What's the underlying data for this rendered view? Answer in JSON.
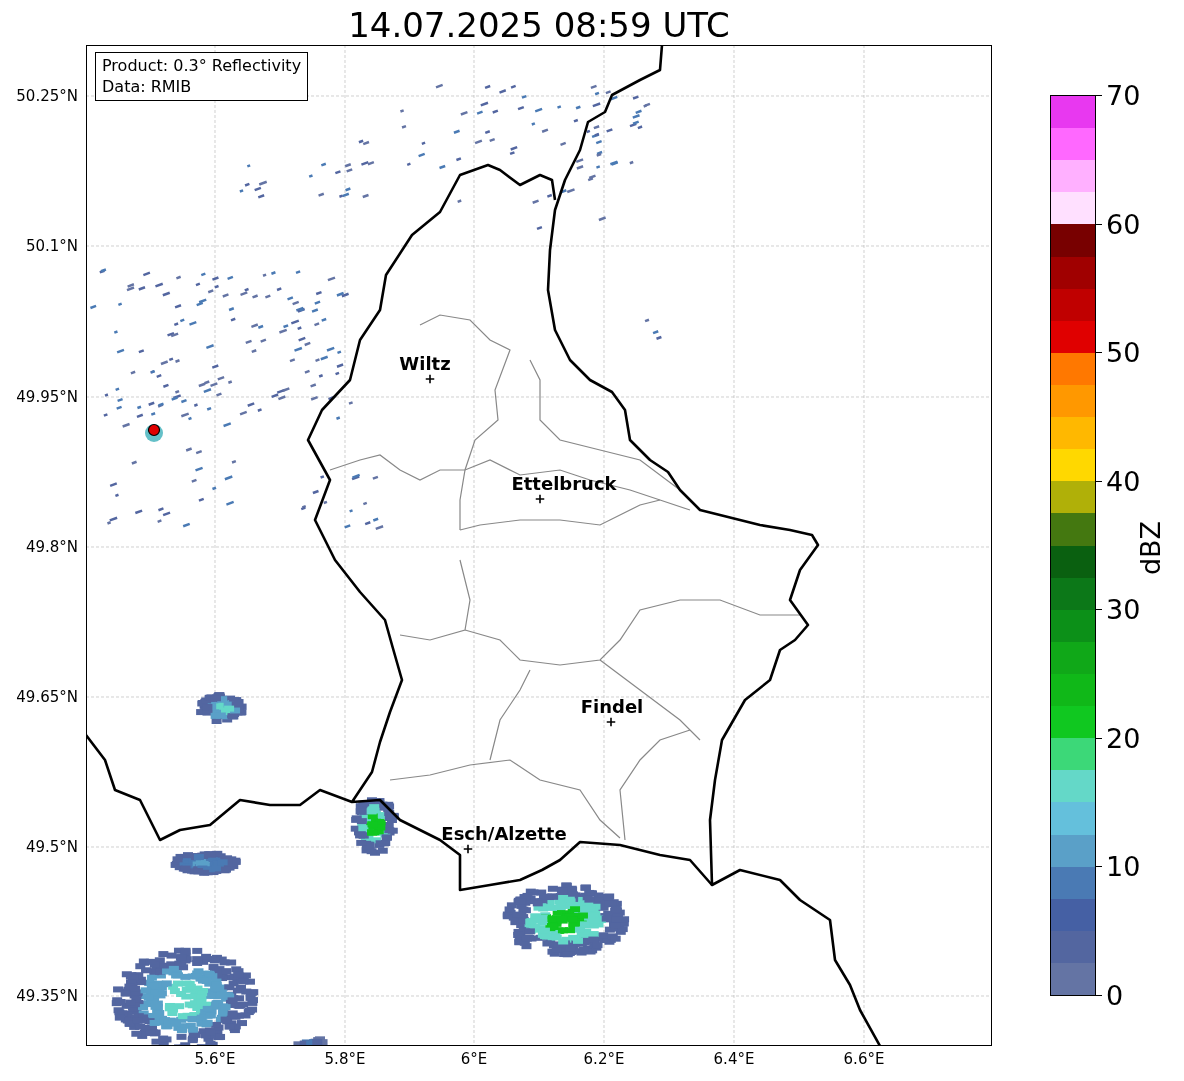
{
  "title": "14.07.2025 08:59 UTC",
  "legend": [
    "Product: 0.3° Reflectivity",
    "Data: RMIB"
  ],
  "cities": [
    {
      "name": "Wiltz"
    },
    {
      "name": "Ettelbruck"
    },
    {
      "name": "Findel"
    },
    {
      "name": "Esch/Alzette"
    }
  ],
  "y_axis": {
    "ticks": [
      "50.25°N",
      "50.1°N",
      "49.95°N",
      "49.8°N",
      "49.65°N",
      "49.5°N",
      "49.35°N"
    ]
  },
  "x_axis": {
    "ticks": [
      "5.6°E",
      "5.8°E",
      "6°E",
      "6.2°E",
      "6.4°E",
      "6.6°E"
    ]
  },
  "colorbar": {
    "label": "dBZ",
    "ticks": [
      "70",
      "60",
      "50",
      "40",
      "30",
      "20",
      "10",
      "0"
    ],
    "bins": [
      {
        "color": "#e838f0"
      },
      {
        "color": "#ff68ff"
      },
      {
        "color": "#ffb0ff"
      },
      {
        "color": "#ffe0ff"
      },
      {
        "color": "#780000"
      },
      {
        "color": "#a00000"
      },
      {
        "color": "#c00000"
      },
      {
        "color": "#e00000"
      },
      {
        "color": "#ff7800"
      },
      {
        "color": "#ff9800"
      },
      {
        "color": "#ffb800"
      },
      {
        "color": "#ffd800"
      },
      {
        "color": "#b0b008"
      },
      {
        "color": "#447810"
      },
      {
        "color": "#0a6010"
      },
      {
        "color": "#0c7818"
      },
      {
        "color": "#0c9018"
      },
      {
        "color": "#10a818"
      },
      {
        "color": "#10b818"
      },
      {
        "color": "#10c820"
      },
      {
        "color": "#3cd878"
      },
      {
        "color": "#64d8c8"
      },
      {
        "color": "#64c0dc"
      },
      {
        "color": "#5aa0c8"
      },
      {
        "color": "#4a7ab4"
      },
      {
        "color": "#4560a4"
      },
      {
        "color": "#5366a0"
      },
      {
        "color": "#6474a4"
      }
    ]
  }
}
